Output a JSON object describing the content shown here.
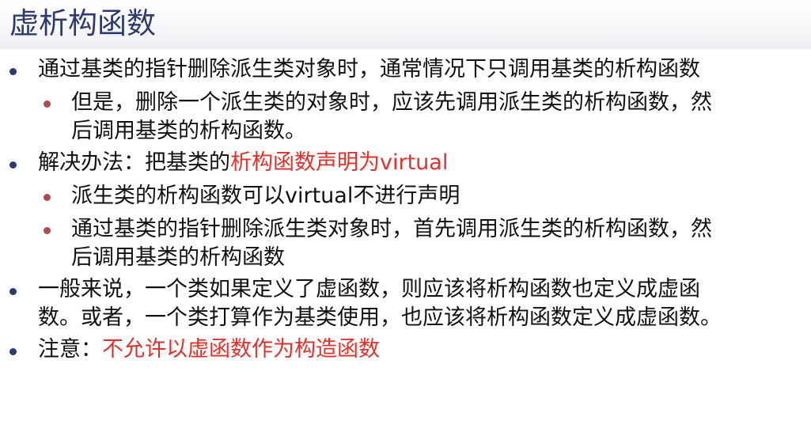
{
  "title": "虚析构函数",
  "bullets": [
    {
      "level": 1,
      "text": "通过基类的指针删除派生类对象时，通常情况下只调用基类的析构函数"
    },
    {
      "level": 2,
      "text": "但是，删除一个派生类的对象时，应该先调用派生类的析构函数，然后调用基类的析构函数。"
    },
    {
      "level": 1,
      "text": "解决办法：把基类的",
      "highlight": "析构函数声明为virtual"
    },
    {
      "level": 2,
      "text": "派生类的析构函数可以virtual不进行声明"
    },
    {
      "level": 2,
      "text": "通过基类的指针删除派生类对象时，首先调用派生类的析构函数，然后调用基类的析构函数"
    },
    {
      "level": 1,
      "text": "一般来说，一个类如果定义了虚函数，则应该将析构函数也定义成虚函数。或者，一个类打算作为基类使用，也应该将析构函数定义成虚函数。"
    },
    {
      "level": 1,
      "text": "注意：",
      "highlight": "不允许以虚函数作为构造函数"
    }
  ],
  "colors": {
    "title": "#2e3a6e",
    "bullet_level1": "#2e3a6e",
    "bullet_level2": "#b04a4a",
    "highlight": "#e2312a",
    "text": "#111111"
  }
}
